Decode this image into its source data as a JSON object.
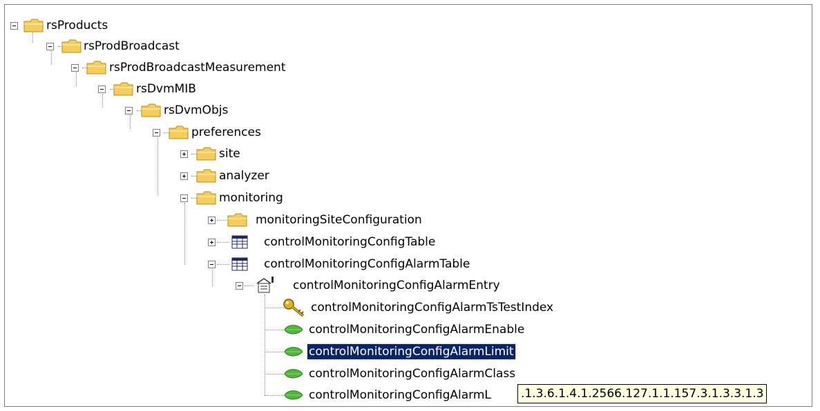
{
  "tree": {
    "nodes": [
      {
        "id": "rsProducts",
        "label": "rsProducts",
        "icon": "folder-icon",
        "toggle": "minus"
      },
      {
        "id": "rsProdBroadcast",
        "label": "rsProdBroadcast",
        "icon": "folder-icon",
        "toggle": "minus"
      },
      {
        "id": "rsProdBroadcastMeasurement",
        "label": "rsProdBroadcastMeasurement",
        "icon": "folder-icon",
        "toggle": "minus"
      },
      {
        "id": "rsDvmMIB",
        "label": "rsDvmMIB",
        "icon": "folder-icon",
        "toggle": "minus"
      },
      {
        "id": "rsDvmObjs",
        "label": "rsDvmObjs",
        "icon": "folder-icon",
        "toggle": "minus"
      },
      {
        "id": "preferences",
        "label": "preferences",
        "icon": "folder-icon",
        "toggle": "minus"
      },
      {
        "id": "site",
        "label": "site",
        "icon": "folder-icon",
        "toggle": "plus"
      },
      {
        "id": "analyzer",
        "label": "analyzer",
        "icon": "folder-icon",
        "toggle": "plus"
      },
      {
        "id": "monitoring",
        "label": "monitoring",
        "icon": "folder-icon",
        "toggle": "minus"
      },
      {
        "id": "monitoringSiteConfiguration",
        "label": "monitoringSiteConfiguration",
        "icon": "folder-icon",
        "toggle": "plus"
      },
      {
        "id": "controlMonitoringConfigTable",
        "label": "controlMonitoringConfigTable",
        "icon": "table-icon",
        "toggle": "plus"
      },
      {
        "id": "controlMonitoringConfigAlarmTable",
        "label": "controlMonitoringConfigAlarmTable",
        "icon": "table-icon",
        "toggle": "minus"
      },
      {
        "id": "controlMonitoringConfigAlarmEntry",
        "label": "controlMonitoringConfigAlarmEntry",
        "icon": "table-entry-icon",
        "toggle": "minus"
      },
      {
        "id": "controlMonitoringConfigAlarmTsTestIndex",
        "label": "controlMonitoringConfigAlarmTsTestIndex",
        "icon": "key-icon",
        "toggle": "none"
      },
      {
        "id": "controlMonitoringConfigAlarmEnable",
        "label": "controlMonitoringConfigAlarmEnable",
        "icon": "leaf-icon",
        "toggle": "none"
      },
      {
        "id": "controlMonitoringConfigAlarmLimit",
        "label": "controlMonitoringConfigAlarmLimit",
        "icon": "leaf-icon",
        "toggle": "none",
        "selected": true
      },
      {
        "id": "controlMonitoringConfigAlarmClass",
        "label": "controlMonitoringConfigAlarmClass",
        "icon": "leaf-icon",
        "toggle": "none"
      },
      {
        "id": "controlMonitoringConfigAlarmL",
        "label": "controlMonitoringConfigAlarmL",
        "icon": "leaf-icon",
        "toggle": "none"
      }
    ]
  },
  "tooltip": {
    "text": ".1.3.6.1.4.1.2566.127.1.1.157.3.1.3.3.1.3"
  },
  "colors": {
    "selection": "#0a246a",
    "tooltip_bg": "#ffffe1",
    "folder": "#f5cd5a",
    "leaf": "#4fb83a",
    "key": "#e0b020"
  }
}
